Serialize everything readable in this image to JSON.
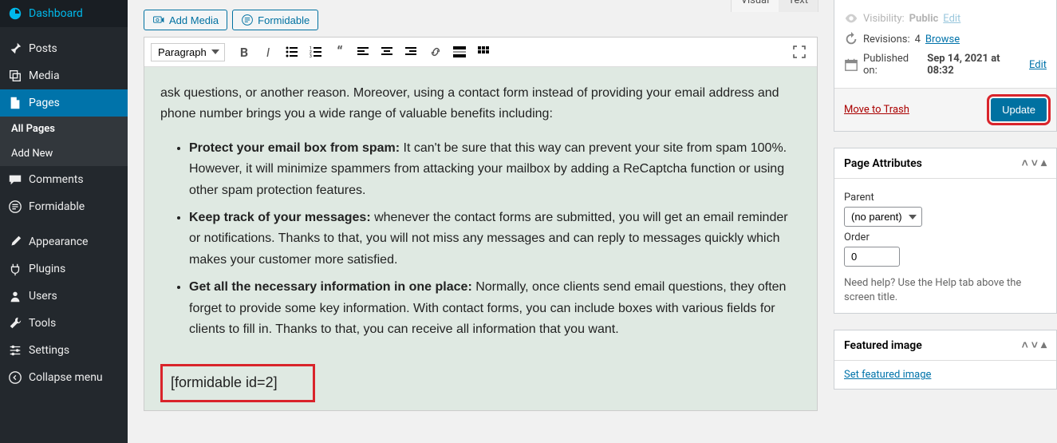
{
  "sidebar": {
    "items": [
      {
        "label": "Dashboard"
      },
      {
        "label": "Posts"
      },
      {
        "label": "Media"
      },
      {
        "label": "Pages"
      },
      {
        "label": "Comments"
      },
      {
        "label": "Formidable"
      },
      {
        "label": "Appearance"
      },
      {
        "label": "Plugins"
      },
      {
        "label": "Users"
      },
      {
        "label": "Tools"
      },
      {
        "label": "Settings"
      },
      {
        "label": "Collapse menu"
      }
    ],
    "subs": {
      "all_pages": "All Pages",
      "add_new": "Add New"
    }
  },
  "editor": {
    "add_media": "Add Media",
    "formidable": "Formidable",
    "tab_visual": "Visual",
    "tab_text": "Text",
    "format": "Paragraph",
    "content": {
      "intro": "ask questions, or another reason. Moreover, using a contact form instead of providing your email address and phone number brings you a wide range of valuable benefits including:",
      "bullets": [
        {
          "bold": "Protect your email box from spam:",
          "text": " It can't be sure that this way can prevent your site from spam 100%. However, it will minimize spammers from attacking your mailbox by adding a ReCaptcha function or using other spam protection features."
        },
        {
          "bold": "Keep track of your messages:",
          "text": " whenever the contact forms are submitted, you will get an email reminder or notifications. Thanks to that, you will not miss any messages and can reply to messages quickly which makes your customer more satisfied."
        },
        {
          "bold": "Get all the necessary information in one place:",
          "text": " Normally, once clients send email questions, they often forget to provide some key information. With contact forms, you can include boxes with various fields for clients to fill in. Thanks to that, you can receive all information that you want."
        }
      ],
      "shortcode": "[formidable id=2]"
    }
  },
  "publish": {
    "visibility_label": "Visibility:",
    "visibility_value": "Public",
    "visibility_edit": "Edit",
    "revisions_label": "Revisions:",
    "revisions_count": "4",
    "revisions_browse": "Browse",
    "published_label": "Published on:",
    "published_value": "Sep 14, 2021 at 08:32",
    "published_edit": "Edit",
    "trash": "Move to Trash",
    "update": "Update"
  },
  "attributes": {
    "title": "Page Attributes",
    "parent_label": "Parent",
    "parent_value": "(no parent)",
    "order_label": "Order",
    "order_value": "0",
    "help": "Need help? Use the Help tab above the screen title."
  },
  "featured": {
    "title": "Featured image",
    "set_link": "Set featured image"
  }
}
